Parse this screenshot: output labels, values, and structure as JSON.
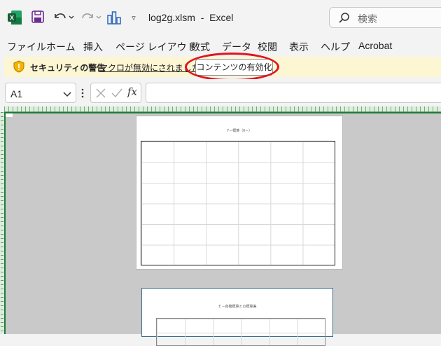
{
  "titlebar": {
    "filename": "log2g.xlsm",
    "separator": "-",
    "app_name": "Excel",
    "search_placeholder": "検索",
    "qat_more": "▿"
  },
  "ribbon": {
    "tabs": [
      "ファイル",
      "ホーム",
      "挿入",
      "ページ レイアウト",
      "数式",
      "データ",
      "校閲",
      "表示",
      "ヘルプ",
      "Acrobat"
    ]
  },
  "message_bar": {
    "title": "セキュリティの警告",
    "text": "マクロが無効にされました。",
    "button_label": "コンテンツの有効化"
  },
  "formula_bar": {
    "name_box": "A1",
    "fx_label": "fx",
    "formula": ""
  },
  "sheet": {
    "chart1_title": "Y－概算（θ－）",
    "chart2_title": "Ｅ－自機概算との概算差"
  },
  "colors": {
    "excel_green": "#1f7a3b",
    "highlight_red": "#e0141e",
    "message_bar_bg": "#fdf6d3"
  },
  "icons": [
    "excel-icon",
    "save-icon",
    "undo-icon",
    "redo-icon",
    "chart-icon",
    "search-icon",
    "shield-warning-icon",
    "chevron-down-icon",
    "cancel-icon",
    "enter-icon"
  ]
}
